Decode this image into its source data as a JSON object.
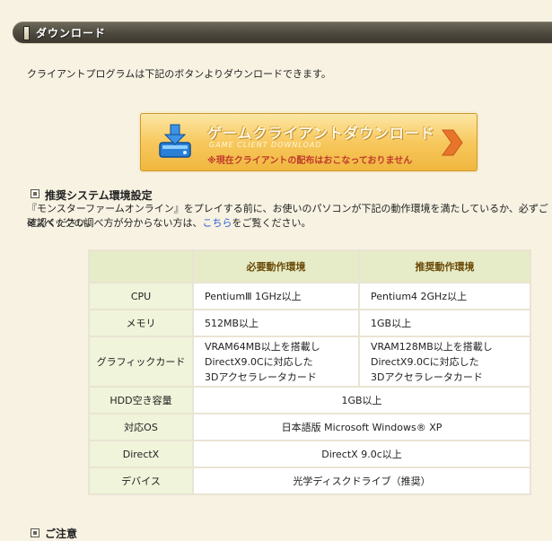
{
  "header": {
    "title": "ダウンロード"
  },
  "intro": "クライアントプログラムは下記のボタンよりダウンロードできます。",
  "download_button": {
    "main_label": "ゲームクライアントダウンロード",
    "sub_label": "GAME CLIENT DOWNLOAD",
    "notice": "※現在クライアントの配布はおこなっておりません"
  },
  "system_section": {
    "title": "推奨システム環境設定",
    "line1": "『モンスターファームオンライン』をプレイする前に、お使いのパソコンが下記の動作環境を満たしているか、必ずご確認ください。",
    "line2_before": "※スペックの調べ方が分からない方は、",
    "line2_link": "こちら",
    "line2_after": "をご覧ください。"
  },
  "table": {
    "col_required": "必要動作環境",
    "col_recommended": "推奨動作環境",
    "rows": [
      {
        "label": "CPU",
        "required": "PentiumⅢ 1GHz以上",
        "recommended": "Pentium4 2GHz以上"
      },
      {
        "label": "メモリ",
        "required": "512MB以上",
        "recommended": "1GB以上"
      },
      {
        "label": "グラフィックカード",
        "required": [
          "VRAM64MB以上を搭載し",
          "DirectX9.0Cに対応した",
          "3Dアクセラレータカード"
        ],
        "recommended": [
          "VRAM128MB以上を搭載し",
          "DirectX9.0Cに対応した",
          "3Dアクセラレータカード"
        ]
      },
      {
        "label": "HDD空き容量",
        "value": "1GB以上"
      },
      {
        "label": "対応OS",
        "value": "日本語版 Microsoft Windows® XP"
      },
      {
        "label": "DirectX",
        "value": "DirectX 9.0c以上"
      },
      {
        "label": "デバイス",
        "value": "光学ディスクドライブ（推奨）"
      }
    ]
  },
  "notes_section": {
    "title": "ご注意"
  },
  "colors": {
    "header_bg": "#4d493e",
    "button_bg": "#f7c85d",
    "notice_red": "#c0392b",
    "link_blue": "#2b5bd7",
    "table_head": "#e6ecc8"
  }
}
